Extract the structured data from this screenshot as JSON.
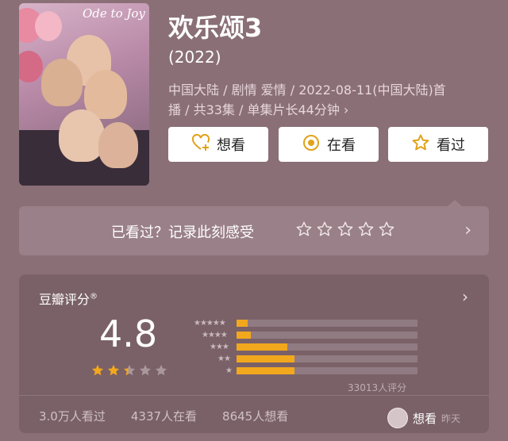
{
  "movie": {
    "poster_title": "Ode to Joy",
    "title": "欢乐颂3",
    "year": "(2022)",
    "meta_line1": "中国大陆 / 剧情 爱情 / 2022-08-11(中国大陆)首",
    "meta_line2": "播 / 共33集 / 单集片长44分钟 ›"
  },
  "actions": {
    "want": "想看",
    "watching": "在看",
    "watched": "看过"
  },
  "record": {
    "text": "已看过？记录此刻感受",
    "chevron": "›"
  },
  "rating": {
    "label": "豆瓣评分",
    "registered": "®",
    "score": "4.8",
    "stars_value": 2.4,
    "stars_max": 5,
    "distribution_percent": [
      3,
      4,
      14,
      16,
      16
    ],
    "distribution_star_labels": [
      "★★★★★",
      "★★★★",
      "★★★",
      "★★",
      "★"
    ],
    "count": "33013人评分",
    "chevron": "›"
  },
  "footer": {
    "watched": "3.0万人看过",
    "watching": "4337人在看",
    "want": "8645人想看"
  },
  "user_activity": {
    "action": "想看",
    "time": "昨天"
  },
  "colors": {
    "background": "#8a6f77",
    "panel": "#7a6168",
    "bar_fill": "#f2a81c",
    "star_gold": "#f2a81c",
    "icon_gold": "#e2a21a"
  }
}
